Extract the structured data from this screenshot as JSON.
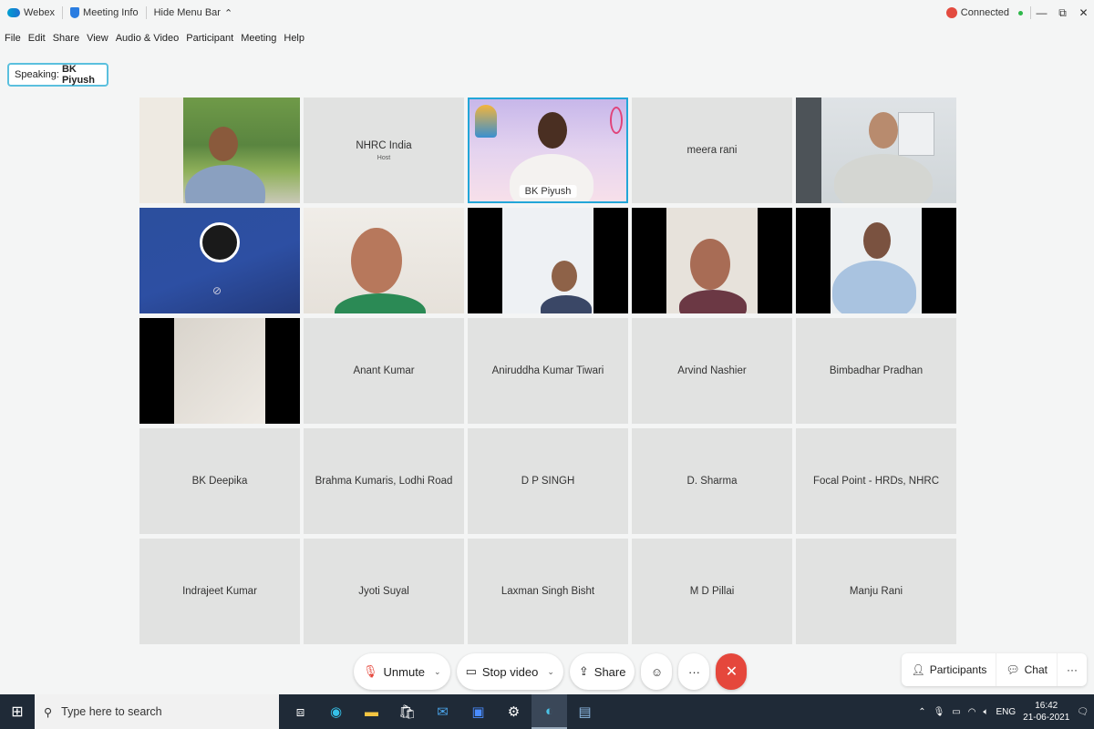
{
  "titlebar": {
    "app_name": "Webex",
    "meeting_info": "Meeting Info",
    "hide_menu": "Hide Menu Bar",
    "status": "Connected",
    "minimize": "—",
    "restore": "⧉",
    "close": "✕"
  },
  "menu": [
    "File",
    "Edit",
    "Share",
    "View",
    "Audio & Video",
    "Participant",
    "Meeting",
    "Help"
  ],
  "speaking": {
    "label": "Speaking:",
    "name": "BK Piyush"
  },
  "tiles": {
    "nhrc": {
      "name": "NHRC India",
      "sub": "Host"
    },
    "piyush": {
      "name": "BK Piyush"
    },
    "meera": {
      "name": "meera rani"
    },
    "names": [
      "Anant Kumar",
      "Aniruddha Kumar Tiwari",
      "Arvind Nashier",
      "Bimbadhar Pradhan",
      "BK Deepika",
      "Brahma Kumaris, Lodhi Road",
      "D P SINGH",
      "D. Sharma",
      "Focal Point - HRDs, NHRC",
      "Indrajeet Kumar",
      "Jyoti Suyal",
      "Laxman Singh Bisht",
      "M D Pillai",
      "Manju Rani"
    ]
  },
  "controls": {
    "unmute": "Unmute",
    "stop_video": "Stop video",
    "share": "Share",
    "more": "···",
    "end": "✕"
  },
  "side": {
    "participants": "Participants",
    "chat": "Chat",
    "more": "···"
  },
  "taskbar": {
    "search_placeholder": "Type here to search",
    "lang": "ENG",
    "time": "16:42",
    "date": "21-06-2021"
  }
}
